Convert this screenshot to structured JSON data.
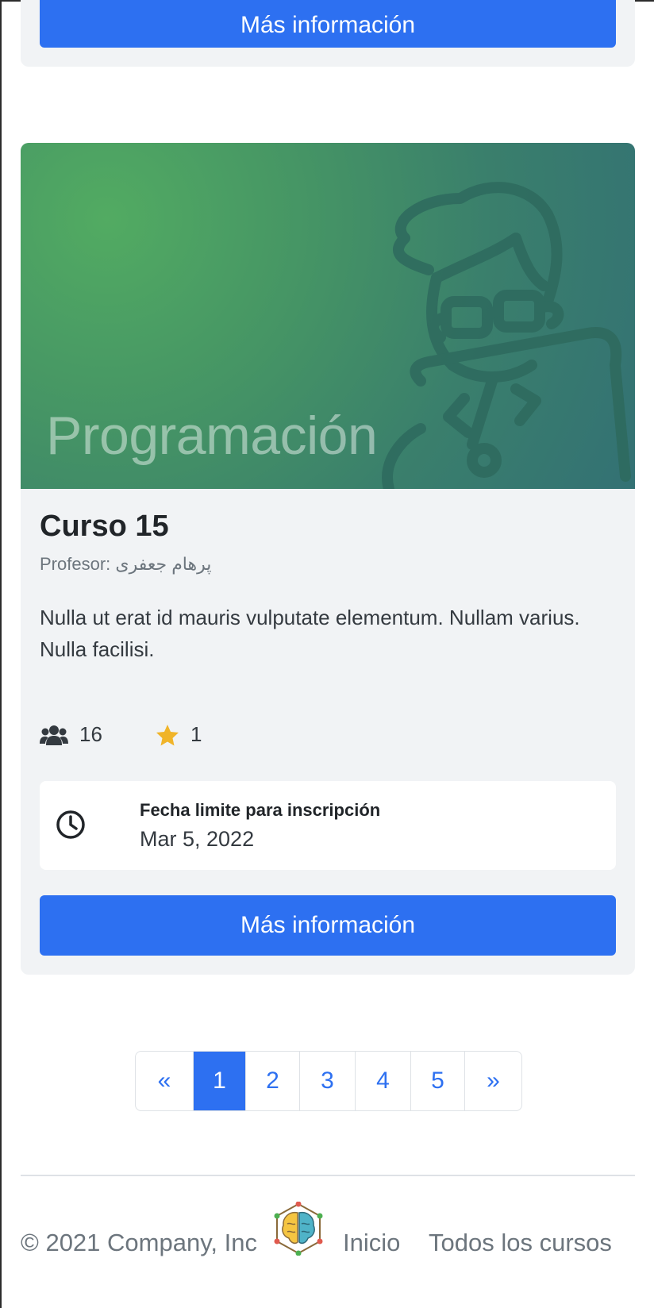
{
  "top_card": {
    "button_label": "Más información"
  },
  "course": {
    "category": "Programación",
    "title": "Curso 15",
    "professor_label": "Profesor: پرهام جعفری",
    "description": "Nulla ut erat id mauris vulputate elementum. Nullam varius. Nulla facilisi.",
    "students_icon": "users-icon",
    "students": "16",
    "rating_icon": "star-icon",
    "rating": "1",
    "deadline_icon": "clock-icon",
    "deadline_label": "Fecha limite para inscripción",
    "deadline_date": "Mar 5, 2022",
    "button_label": "Más información"
  },
  "pagination": {
    "prev": "«",
    "pages": [
      "1",
      "2",
      "3",
      "4",
      "5"
    ],
    "active_page": "1",
    "next": "»"
  },
  "footer": {
    "copyright": "© 2021 Company, Inc",
    "logo_icon": "brain-logo-icon",
    "links": [
      "Inicio",
      "Todos los cursos"
    ]
  },
  "colors": {
    "primary": "#2d70f1",
    "card_bg": "#f1f3f5",
    "hero_green": "#52ab62",
    "hero_teal": "#337174",
    "star": "#f0b429"
  }
}
